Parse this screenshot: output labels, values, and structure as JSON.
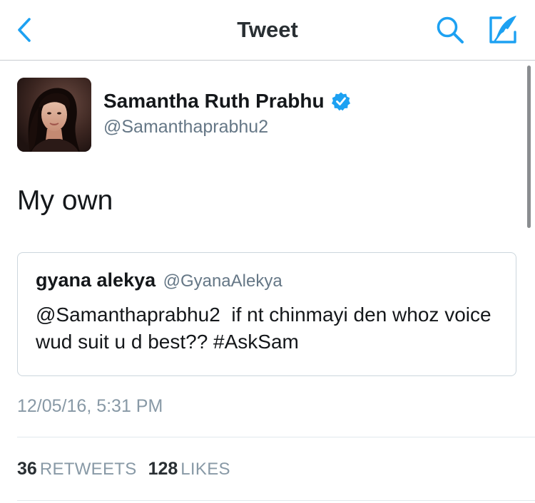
{
  "colors": {
    "accent": "#1da1f2",
    "text_primary": "#14171a",
    "text_secondary": "#657786",
    "border": "#ccd6dd",
    "verified_badge": "#1da1f2"
  },
  "navbar": {
    "title": "Tweet",
    "back_icon": "chevron-left-icon",
    "search_icon": "search-icon",
    "compose_icon": "compose-tweet-icon"
  },
  "tweet": {
    "author": {
      "name": "Samantha Ruth Prabhu",
      "handle": "@Samanthaprabhu2",
      "verified": true,
      "avatar_icon": "profile-photo"
    },
    "text": "My own",
    "quoted": {
      "name": "gyana alekya",
      "handle": "@GyanaAlekya",
      "text": "@Samanthaprabhu2  if nt chinmayi den whoz voice wud suit u d best?? #AskSam"
    },
    "timestamp": "12/05/16, 5:31 PM",
    "stats": {
      "retweets_count": "36",
      "retweets_label": "RETWEETS",
      "likes_count": "128",
      "likes_label": "LIKES"
    }
  }
}
